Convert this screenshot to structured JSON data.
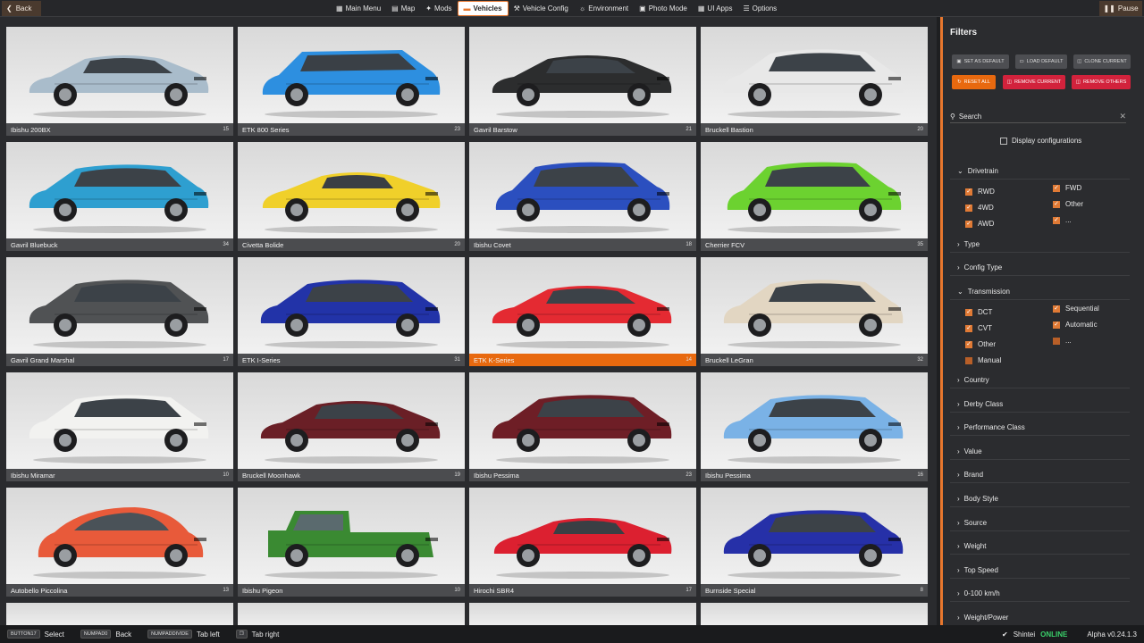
{
  "topbar": {
    "back_label": "Back",
    "pause_label": "Pause",
    "nav": [
      {
        "label": "Main Menu",
        "icon": "grid-icon"
      },
      {
        "label": "Map",
        "icon": "map-icon"
      },
      {
        "label": "Mods",
        "icon": "puzzle-icon"
      },
      {
        "label": "Vehicles",
        "icon": "car-icon",
        "active": true
      },
      {
        "label": "Vehicle Config",
        "icon": "wrench-icon"
      },
      {
        "label": "Environment",
        "icon": "sun-icon"
      },
      {
        "label": "Photo Mode",
        "icon": "camera-icon"
      },
      {
        "label": "UI Apps",
        "icon": "apps-icon"
      },
      {
        "label": "Options",
        "icon": "sliders-icon"
      }
    ]
  },
  "vehicles": [
    {
      "name": "Ibishu 200BX",
      "count": "15",
      "color": "#a9bccb",
      "style": "coupe"
    },
    {
      "name": "ETK 800 Series",
      "count": "23",
      "color": "#2d8fe0",
      "style": "wagon"
    },
    {
      "name": "Gavril Barstow",
      "count": "21",
      "color": "#2c2d2e",
      "style": "coupe"
    },
    {
      "name": "Bruckell Bastion",
      "count": "20",
      "color": "#e8e8e8",
      "style": "sedan"
    },
    {
      "name": "Gavril Bluebuck",
      "count": "34",
      "color": "#2e9fd0",
      "style": "sedan"
    },
    {
      "name": "Civetta Bolide",
      "count": "20",
      "color": "#f0d02a",
      "style": "sport"
    },
    {
      "name": "Ibishu Covet",
      "count": "18",
      "color": "#2b4fbf",
      "style": "hatch"
    },
    {
      "name": "Cherrier FCV",
      "count": "35",
      "color": "#6cd230",
      "style": "hatch"
    },
    {
      "name": "Gavril Grand Marshal",
      "count": "17",
      "color": "#505254",
      "style": "sedan"
    },
    {
      "name": "ETK I-Series",
      "count": "31",
      "color": "#2233a8",
      "style": "sedan"
    },
    {
      "name": "ETK K-Series",
      "count": "14",
      "color": "#e42a32",
      "style": "coupe",
      "selected": true
    },
    {
      "name": "Bruckell LeGran",
      "count": "32",
      "color": "#e2d6c2",
      "style": "sedan"
    },
    {
      "name": "Ibishu Miramar",
      "count": "10",
      "color": "#f2f2f0",
      "style": "sedan"
    },
    {
      "name": "Bruckell Moonhawk",
      "count": "19",
      "color": "#6a1f26",
      "style": "coupe"
    },
    {
      "name": "Ibishu Pessima",
      "count": "23",
      "color": "#6e1e26",
      "style": "sedan"
    },
    {
      "name": "Ibishu Pessima",
      "count": "16",
      "color": "#7ab2e6",
      "style": "sedan"
    },
    {
      "name": "Autobello Piccolina",
      "count": "13",
      "color": "#e85a3a",
      "style": "bubble"
    },
    {
      "name": "Ibishu Pigeon",
      "count": "10",
      "color": "#3a8a32",
      "style": "truck"
    },
    {
      "name": "Hirochi SBR4",
      "count": "17",
      "color": "#dc2030",
      "style": "sport"
    },
    {
      "name": "Burnside Special",
      "count": "8",
      "color": "#2630a8",
      "style": "sedan"
    }
  ],
  "filters": {
    "title": "Filters",
    "buttons": {
      "set_default": "SET AS DEFAULT",
      "load_default": "LOAD DEFAULT",
      "clone_current": "CLONE CURRENT",
      "reset_all": "RESET ALL",
      "remove_current": "REMOVE CURRENT",
      "remove_others": "REMOVE OTHERS"
    },
    "search_label": "Search",
    "display_configurations": "Display configurations",
    "drivetrain": {
      "label": "Drivetrain",
      "left": [
        "RWD",
        "4WD",
        "AWD"
      ],
      "right": [
        "FWD",
        "Other",
        "..."
      ]
    },
    "type_label": "Type",
    "config_type_label": "Config Type",
    "transmission": {
      "label": "Transmission",
      "left": [
        "DCT",
        "CVT",
        "Other",
        "Manual"
      ],
      "right": [
        "Sequential",
        "Automatic",
        "..."
      ]
    },
    "sections": [
      "Country",
      "Derby Class",
      "Performance Class",
      "Value",
      "Brand",
      "Body Style",
      "Source",
      "Weight",
      "Top Speed",
      "0-100 km/h",
      "Weight/Power"
    ]
  },
  "bottombar": {
    "hints": [
      {
        "key": "BUTTON17",
        "label": "Select"
      },
      {
        "key": "NUMPAD0",
        "label": "Back"
      },
      {
        "key": "NUMPADDIVIDE",
        "label": "Tab left"
      },
      {
        "key": "❐",
        "label": "Tab right"
      }
    ],
    "user": "Shintei",
    "online": "ONLINE",
    "version": "Alpha v0.24.1.3"
  }
}
